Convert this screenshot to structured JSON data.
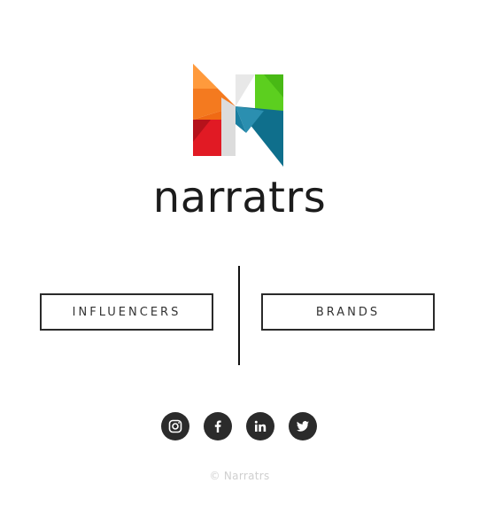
{
  "brand": {
    "wordmark": "narratrs",
    "logo_icon": "narratrs-n-logo-icon"
  },
  "buttons": {
    "influencers_label": "INFLUENCERS",
    "brands_label": "BRANDS"
  },
  "social": [
    {
      "name": "instagram",
      "icon": "instagram-icon"
    },
    {
      "name": "facebook",
      "icon": "facebook-icon"
    },
    {
      "name": "linkedin",
      "icon": "linkedin-icon"
    },
    {
      "name": "twitter",
      "icon": "twitter-icon"
    }
  ],
  "footer": {
    "copyright": "© Narratrs"
  },
  "colors": {
    "orange": "#f47a1f",
    "green": "#5ccf1f",
    "red": "#e11a24",
    "teal": "#0f6f8c",
    "dark": "#2b2b2b"
  }
}
